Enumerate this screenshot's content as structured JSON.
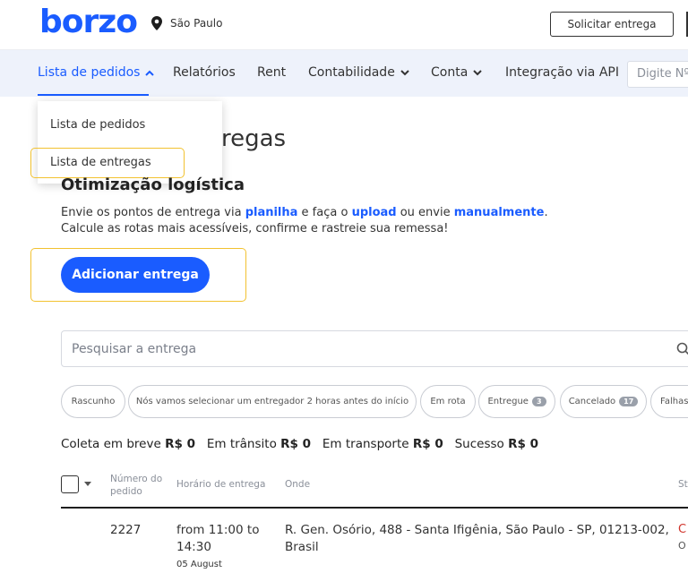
{
  "header": {
    "logo_text": "borzo",
    "city": "São Paulo",
    "request_button": "Solicitar entrega"
  },
  "nav": {
    "items": [
      {
        "label": "Lista de pedidos"
      },
      {
        "label": "Relatórios"
      },
      {
        "label": "Rent"
      },
      {
        "label": "Contabilidade"
      },
      {
        "label": "Conta"
      },
      {
        "label": "Integração via API"
      }
    ],
    "search_placeholder": "Digite Nº"
  },
  "dropdown": {
    "items": [
      {
        "label": "Lista de pedidos"
      },
      {
        "label": "Lista de entregas"
      }
    ]
  },
  "page": {
    "title_visible": "regas",
    "section_title": "Otimização logística",
    "desc": {
      "line1_a": "Envie os pontos de entrega via ",
      "line1_link1": "planilha",
      "line1_b": " e faça o ",
      "line1_link2": "upload",
      "line1_c": " ou envie ",
      "line1_link3": "manualmente",
      "line1_d": ".",
      "line2": "Calcule as rotas mais acessíveis, confirme e rastreie sua remessa!"
    },
    "add_button": "Adicionar entrega"
  },
  "search": {
    "placeholder": "Pesquisar a entrega"
  },
  "filters": [
    {
      "label": "Rascunho"
    },
    {
      "label": "Nós vamos selecionar um entregador 2 horas antes do início"
    },
    {
      "label": "Em rota"
    },
    {
      "label": "Entregue",
      "count": "3"
    },
    {
      "label": "Cancelado",
      "count": "17"
    },
    {
      "label": "Falhas"
    }
  ],
  "summary": {
    "s1_label": "Coleta em breve",
    "s1_value": "R$ 0",
    "s2_label": "Em trânsito",
    "s2_value": "R$ 0",
    "s3_label": "Em transporte",
    "s3_value": "R$ 0",
    "s4_label": "Sucesso",
    "s4_value": "R$ 0"
  },
  "table": {
    "columns": {
      "number_line1": "Número do",
      "number_line2": "pedido",
      "time": "Horário de entrega",
      "where": "Onde",
      "status": "St"
    },
    "rows": [
      {
        "number": "2227",
        "time_line1": "from 11:00 to",
        "time_line2": "14:30",
        "time_line3": "05 August",
        "address_line1": "R. Gen. Osório, 488 - Santa Ifigênia, São Paulo - SP, 01213-002,",
        "address_line2": "Brasil",
        "status": "C",
        "status_sub": "O"
      }
    ]
  },
  "colors": {
    "brand": "#1a5cff",
    "highlight": "#f2c230",
    "status_red": "#d0342c"
  }
}
